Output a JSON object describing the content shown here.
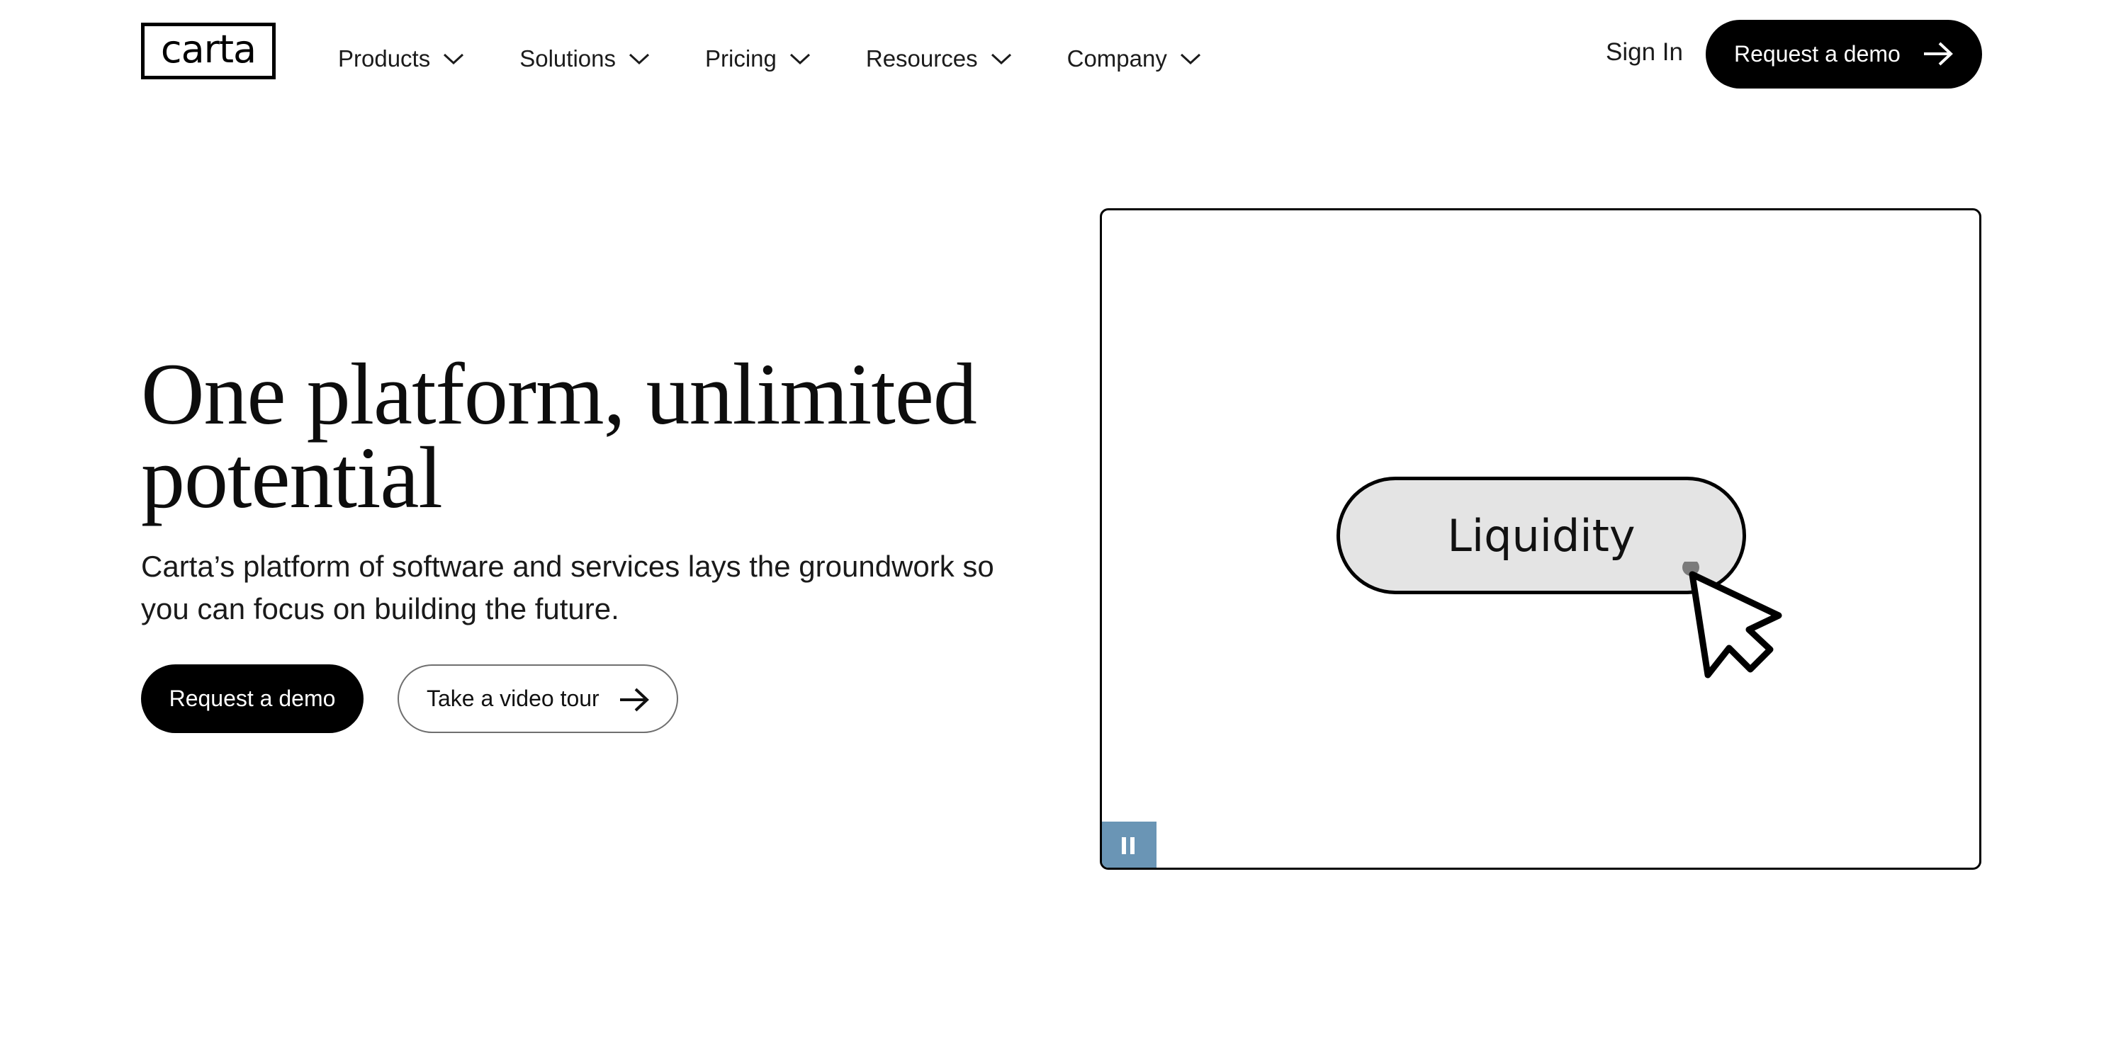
{
  "header": {
    "logo_text": "carta",
    "nav": [
      {
        "label": "Products"
      },
      {
        "label": "Solutions"
      },
      {
        "label": "Pricing"
      },
      {
        "label": "Resources"
      },
      {
        "label": "Company"
      }
    ],
    "sign_in": "Sign In",
    "cta": "Request a demo",
    "cta_icon": "arrow-right-icon",
    "nav_icon": "chevron-down-icon"
  },
  "hero": {
    "title": "One platform, unlimited potential",
    "subtitle": "Carta’s platform of software and services lays the groundwork so you can focus on building the future.",
    "primary_button": "Request a demo",
    "secondary_button": "Take a video tour",
    "secondary_icon": "arrow-right-icon"
  },
  "media": {
    "pill_label": "Liquidity",
    "cursor_icon": "mouse-pointer-icon",
    "control_icon": "pause-icon",
    "control_color": "#6a95b5"
  },
  "colors": {
    "primary": "#000000",
    "background": "#ffffff",
    "pill_fill": "#e4e4e4"
  }
}
